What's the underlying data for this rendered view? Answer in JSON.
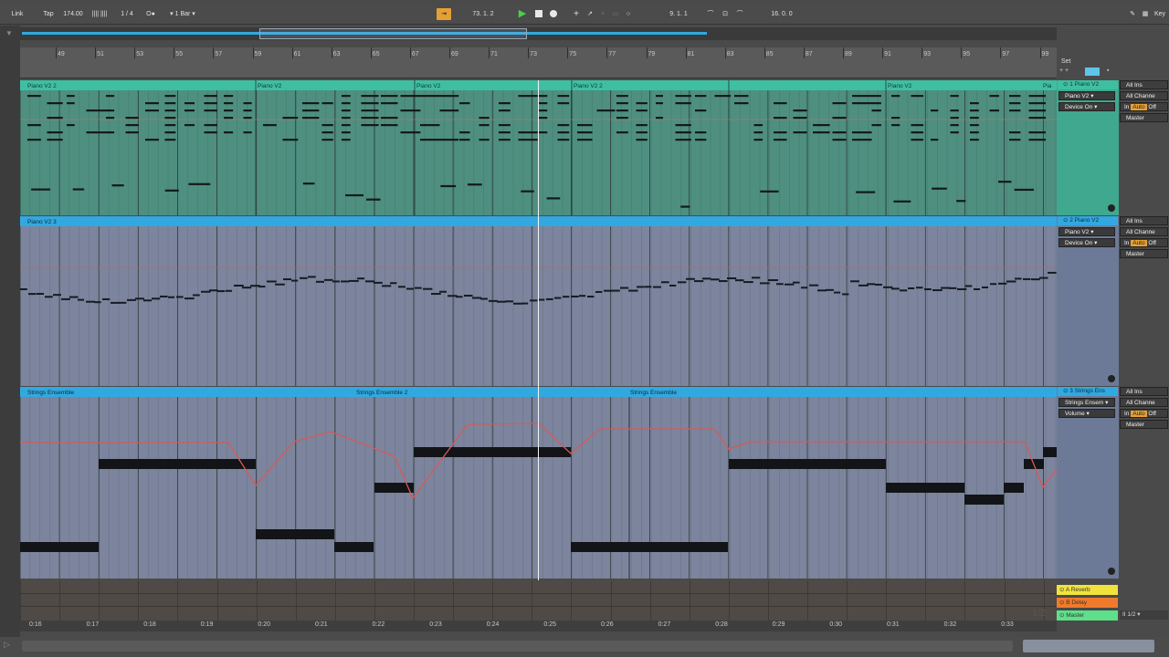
{
  "toolbar": {
    "link_label": "Link",
    "tap_label": "Tap",
    "tempo": "174.00",
    "tempo_bars": "||||  ||||",
    "time_signature": "1 / 4",
    "metronome": "O●",
    "quantize": "1 Bar",
    "position": "73.  1.  2",
    "loop_start": "9.  1.  1",
    "loop_length": "16.  0.  0",
    "key_label": "Key",
    "accent_color": "#e5a034"
  },
  "ruler": {
    "bars": [
      "49",
      "51",
      "53",
      "55",
      "57",
      "59",
      "61",
      "63",
      "65",
      "67",
      "69",
      "71",
      "73",
      "75",
      "77",
      "79",
      "81",
      "83",
      "85",
      "87",
      "89",
      "91",
      "93",
      "95",
      "97",
      "99"
    ],
    "set_label": "Set"
  },
  "tracks": [
    {
      "name": "1 Piano V2",
      "color": "#3fbfa2",
      "clips": [
        "Piano V2 2",
        "Piano V2",
        "Piano V2",
        "Piano V2 2",
        "Piano V2",
        "Pia"
      ],
      "instrument": "Piano V2",
      "device": "Device On",
      "input": "All Ins",
      "channel": "All Channe",
      "monitor": [
        "In",
        "Auto",
        "Off"
      ],
      "output": "Master"
    },
    {
      "name": "2 Piano V2",
      "color": "#31a9e0",
      "clips": [
        "Piano V2 3"
      ],
      "instrument": "Piano V2",
      "device": "Device On",
      "input": "All Ins",
      "channel": "All Channe",
      "monitor": [
        "In",
        "Auto",
        "Off"
      ],
      "output": "Master"
    },
    {
      "name": "3 Strings Ens",
      "color": "#31a9e0",
      "clips": [
        "Strings Ensemble",
        "Strings Ensemble 2",
        "Strings Ensemble"
      ],
      "instrument": "Strings Ensem",
      "device": "Volume",
      "input": "All Ins",
      "channel": "All Channe",
      "monitor": [
        "In",
        "Auto",
        "Off"
      ],
      "output": "Master"
    }
  ],
  "returns": [
    {
      "name": "A Reverb",
      "color": "#f2e33c"
    },
    {
      "name": "B Delay",
      "color": "#f07a2c"
    },
    {
      "name": "Master",
      "color": "#5ee08a"
    }
  ],
  "master_io": "II 1/2",
  "return_tag": "1/2",
  "timeline": [
    "0:16",
    "0:17",
    "0:18",
    "0:19",
    "0:20",
    "0:21",
    "0:22",
    "0:23",
    "0:24",
    "0:25",
    "0:26",
    "0:27",
    "0:28",
    "0:29",
    "0:30",
    "0:31",
    "0:32",
    "0:33"
  ]
}
